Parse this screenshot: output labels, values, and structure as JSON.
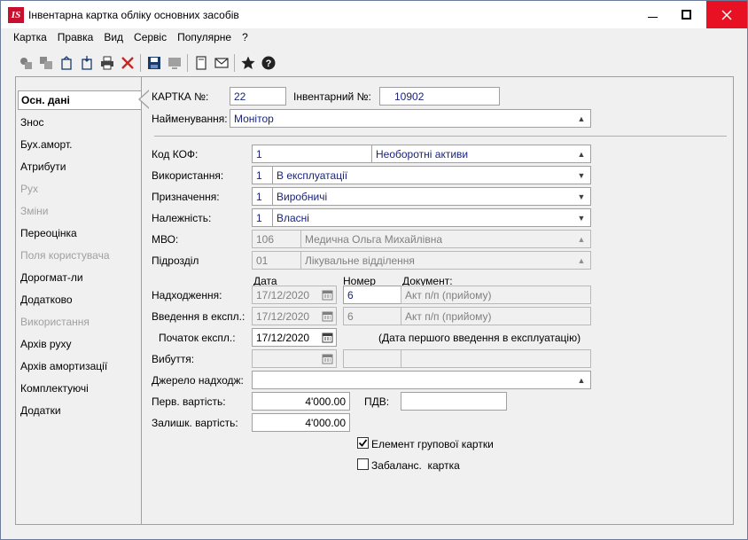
{
  "window": {
    "icon_text": "IS",
    "title": "Інвентарна картка обліку основних засобів"
  },
  "menu": [
    "Картка",
    "Правка",
    "Вид",
    "Сервіс",
    "Популярне",
    "?"
  ],
  "toolbar_icons": [
    "copy-icon",
    "paste-icon",
    "export-icon",
    "import-icon",
    "print-icon",
    "delete-icon",
    "save-icon",
    "monitor-icon",
    "document-icon",
    "mail-icon",
    "star-icon",
    "help-icon"
  ],
  "tabs": [
    {
      "label": "Осн. дані",
      "active": true,
      "disabled": false
    },
    {
      "label": "Знос",
      "active": false,
      "disabled": false
    },
    {
      "label": "Бух.аморт.",
      "active": false,
      "disabled": false
    },
    {
      "label": "Атрибути",
      "active": false,
      "disabled": false
    },
    {
      "label": "Рух",
      "active": false,
      "disabled": true
    },
    {
      "label": "Зміни",
      "active": false,
      "disabled": true
    },
    {
      "label": "Переоцінка",
      "active": false,
      "disabled": false
    },
    {
      "label": "Поля користувача",
      "active": false,
      "disabled": true
    },
    {
      "label": "Дорогмат-ли",
      "active": false,
      "disabled": false
    },
    {
      "label": "Додатково",
      "active": false,
      "disabled": false
    },
    {
      "label": "Використання",
      "active": false,
      "disabled": true
    },
    {
      "label": "Архів руху",
      "active": false,
      "disabled": false
    },
    {
      "label": "Архів амортизації",
      "active": false,
      "disabled": false
    },
    {
      "label": "Комплектуючі",
      "active": false,
      "disabled": false
    },
    {
      "label": "Додатки",
      "active": false,
      "disabled": false
    }
  ],
  "form": {
    "card_no_label": "КАРТКА №:",
    "card_no": "22",
    "inv_no_label": "Інвентарний №:",
    "inv_no": "10902",
    "name_label": "Найменування:",
    "name": "Монітор",
    "kof_label": "Код КОФ:",
    "kof_code": "1",
    "kof_name": "Необоротні активи",
    "usage_label": "Використання:",
    "usage_code": "1",
    "usage_name": "В експлуатації",
    "purpose_label": "Призначення:",
    "purpose_code": "1",
    "purpose_name": "Виробничі",
    "ownership_label": "Належність:",
    "ownership_code": "1",
    "ownership_name": "Власні",
    "mvo_label": "МВО:",
    "mvo_code": "106",
    "mvo_name": "Медична Ольга Михайлівна",
    "dept_label": "Підрозділ",
    "dept_code": "01",
    "dept_name": "Лікувальне відділення",
    "col_date": "Дата",
    "col_number": "Номер",
    "col_document": "Документ:",
    "receipt_label": "Надходження:",
    "receipt_date": "17/12/2020",
    "receipt_number": "6",
    "receipt_doc": "Акт п/п (прийому)",
    "commission_label": "Введення в експл.:",
    "commission_date": "17/12/2020",
    "commission_number": "6",
    "commission_doc": "Акт п/п (прийому)",
    "start_label": "Початок експл.:",
    "start_date": "17/12/2020",
    "start_note": "(Дата першого введення в експлуатацію)",
    "disposal_label": "Вибуття:",
    "source_label": "Джерело надходж:",
    "initial_cost_label": "Перв. вартість:",
    "initial_cost": "4'000.00",
    "vat_label": "ПДВ:",
    "residual_cost_label": "Залишк. вартість:",
    "residual_cost": "4'000.00",
    "group_card_label": "Елемент групової картки",
    "group_card_checked": true,
    "offbalance_label": "Забаланс.  картка",
    "offbalance_checked": false
  }
}
